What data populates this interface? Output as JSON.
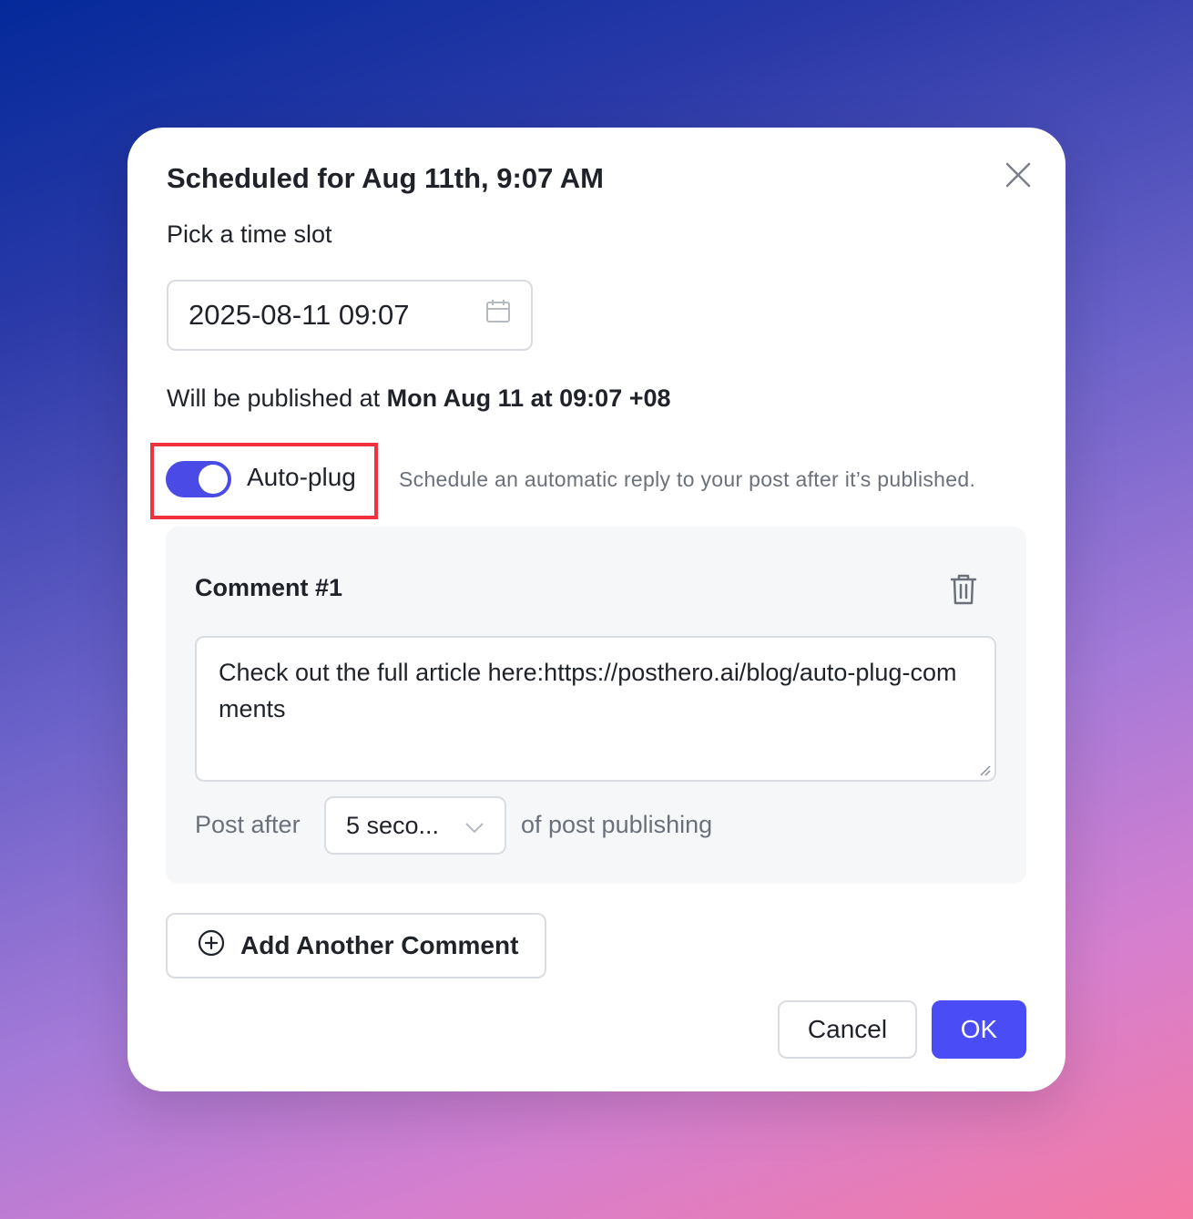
{
  "modal": {
    "title": "Scheduled for Aug 11th, 9:07 AM",
    "subtitle": "Pick a time slot",
    "datetime_value": "2025-08-11 09:07",
    "publish_prefix": "Will be published at ",
    "publish_time": "Mon Aug 11 at 09:07 +08"
  },
  "autoplug": {
    "enabled": true,
    "label": "Auto-plug",
    "description": "Schedule an automatic reply to your post after it’s published."
  },
  "comments": [
    {
      "title": "Comment #1",
      "text": "Check out the full article here:https://posthero.ai/blog/auto-plug-comments",
      "post_after_label": "Post after",
      "delay_selected": "5 seco...",
      "suffix_label": "of post publishing"
    }
  ],
  "actions": {
    "add_comment": "Add Another Comment",
    "cancel": "Cancel",
    "ok": "OK"
  },
  "colors": {
    "accent": "#4a4cf6",
    "highlight_border": "#f0313e"
  },
  "icons": {
    "close": "close-icon",
    "calendar": "calendar-icon",
    "trash": "trash-icon",
    "chevron": "chevron-down-icon",
    "add": "plus-circle-icon"
  }
}
